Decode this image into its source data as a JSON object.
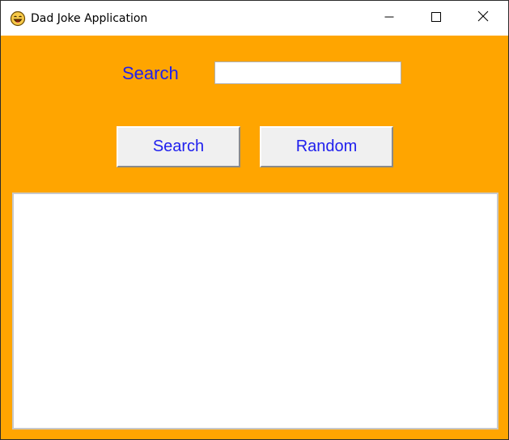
{
  "window": {
    "title": "Dad Joke Application",
    "app_icon": "laughing-face-icon",
    "controls": [
      "minimize-icon",
      "maximize-icon",
      "close-icon"
    ]
  },
  "search": {
    "label": "Search",
    "value": "",
    "placeholder": ""
  },
  "buttons": {
    "search_label": "Search",
    "random_label": "Random"
  },
  "output": {
    "text": ""
  },
  "colors": {
    "background": "#ffa500",
    "text_accent": "#2020ee",
    "button_face": "#f0f0f0",
    "titlebar": "#ffffff"
  }
}
